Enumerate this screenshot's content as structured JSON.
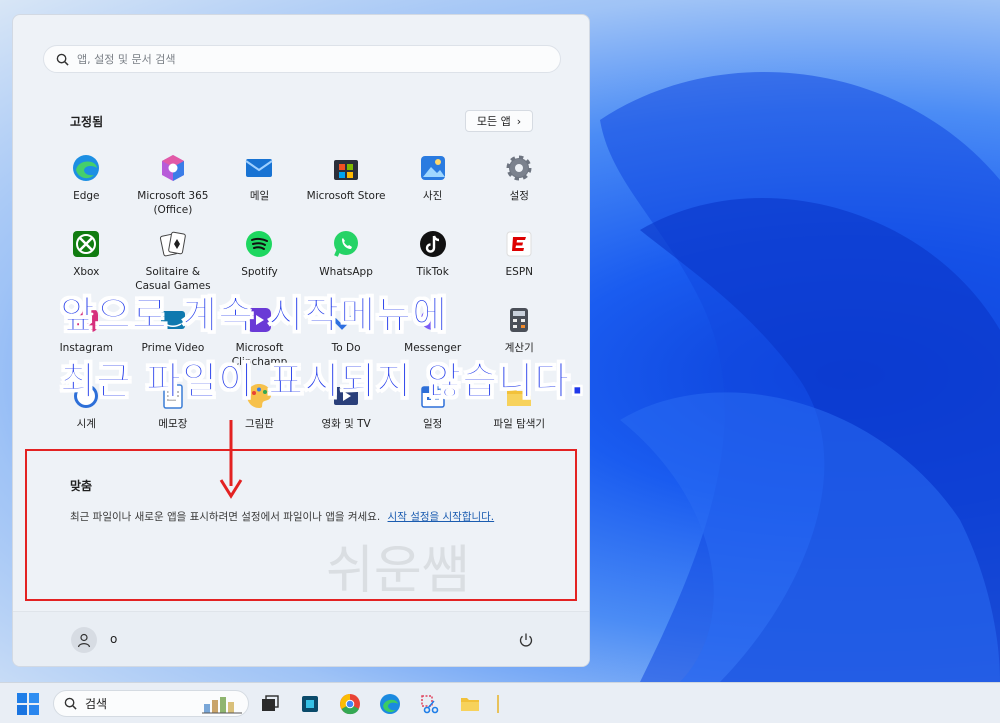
{
  "search": {
    "placeholder": "앱, 설정 및 문서 검색"
  },
  "pinned": {
    "title": "고정됨",
    "all_apps_label": "모든 앱",
    "apps": [
      {
        "label": "Edge",
        "icon": "edge-icon"
      },
      {
        "label": "Microsoft 365\n(Office)",
        "icon": "microsoft-365-icon"
      },
      {
        "label": "메일",
        "icon": "mail-icon"
      },
      {
        "label": "Microsoft Store",
        "icon": "store-icon"
      },
      {
        "label": "사진",
        "icon": "photos-icon"
      },
      {
        "label": "설정",
        "icon": "settings-gear-icon"
      },
      {
        "label": "Xbox",
        "icon": "xbox-icon"
      },
      {
        "label": "Solitaire &\nCasual Games",
        "icon": "solitaire-icon"
      },
      {
        "label": "Spotify",
        "icon": "spotify-icon"
      },
      {
        "label": "WhatsApp",
        "icon": "whatsapp-icon"
      },
      {
        "label": "TikTok",
        "icon": "tiktok-icon"
      },
      {
        "label": "ESPN",
        "icon": "espn-icon"
      },
      {
        "label": "Instagram",
        "icon": "instagram-icon"
      },
      {
        "label": "Prime Video",
        "icon": "prime-video-icon"
      },
      {
        "label": "Microsoft\nClipchamp",
        "icon": "clipchamp-icon"
      },
      {
        "label": "To Do",
        "icon": "todo-icon"
      },
      {
        "label": "Messenger",
        "icon": "messenger-icon"
      },
      {
        "label": "계산기",
        "icon": "calculator-icon"
      },
      {
        "label": "시계",
        "icon": "clock-icon"
      },
      {
        "label": "메모장",
        "icon": "notepad-icon"
      },
      {
        "label": "그림판",
        "icon": "paint-icon"
      },
      {
        "label": "영화 및 TV",
        "icon": "movies-tv-icon"
      },
      {
        "label": "일정",
        "icon": "calendar-icon"
      },
      {
        "label": "파일 탐색기",
        "icon": "file-explorer-icon"
      }
    ]
  },
  "recommended": {
    "title": "맞춤",
    "message": "최근 파일이나 새로운 앱을 표시하려면 설정에서 파일이나 앱을 켜세요.",
    "link": "시작 설정을 시작합니다."
  },
  "footer": {
    "user_name": "o"
  },
  "annotation": {
    "line1": "앞으로 계속 시작메뉴에",
    "line2": "최근 파일이 표시되지 않습니다.",
    "watermark": "쉬운쌤"
  },
  "taskbar": {
    "search_label": "검색"
  },
  "colors": {
    "accent": "#1f38ea",
    "highlight_box": "#e32222",
    "link": "#1b5cb0"
  }
}
